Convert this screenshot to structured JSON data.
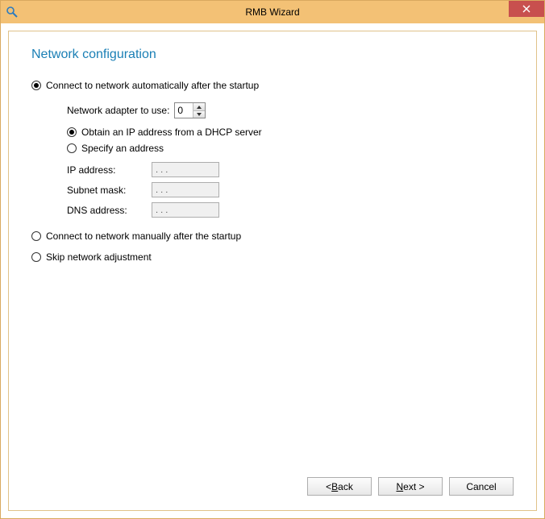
{
  "window": {
    "title": "RMB Wizard"
  },
  "page": {
    "heading": "Network configuration"
  },
  "options": {
    "auto": {
      "label": "Connect to network automatically after the startup",
      "adapter_label": "Network adapter to use:",
      "adapter_value": "0",
      "dhcp_label": "Obtain an IP address from a DHCP server",
      "specify_label": "Specify an address",
      "ip_label": "IP address:",
      "ip_value": ".   .   .",
      "subnet_label": "Subnet mask:",
      "subnet_value": ".   .   .",
      "dns_label": "DNS address:",
      "dns_value": ".   .   ."
    },
    "manual_label": "Connect to network manually after the startup",
    "skip_label": "Skip network adjustment"
  },
  "buttons": {
    "back_prefix": "< ",
    "back_u": "B",
    "back_rest": "ack",
    "next_u": "N",
    "next_rest": "ext >",
    "cancel": "Cancel"
  }
}
